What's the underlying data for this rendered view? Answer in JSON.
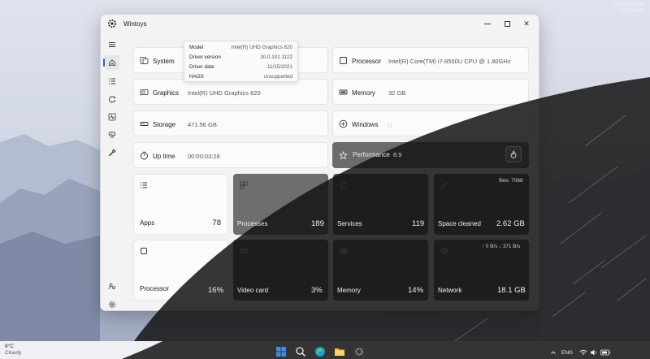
{
  "window": {
    "title": "Wintoys",
    "app_icon": "gear-badge-icon"
  },
  "nav": {
    "items": [
      {
        "name": "home",
        "icon": "home-icon",
        "active": true
      },
      {
        "name": "apps",
        "icon": "list-icon"
      },
      {
        "name": "services",
        "icon": "services-icon"
      },
      {
        "name": "performance",
        "icon": "activity-icon"
      },
      {
        "name": "health",
        "icon": "heart-pulse-icon"
      },
      {
        "name": "tools",
        "icon": "wrench-icon"
      },
      {
        "name": "extras",
        "icon": "people-icon"
      },
      {
        "name": "settings",
        "icon": "gear-icon"
      }
    ]
  },
  "system_info": {
    "system_label": "System",
    "processor_label": "Processor",
    "processor_value": "Intel(R) Core(TM) i7-8550U CPU @ 1.80GHz",
    "graphics_label": "Graphics",
    "graphics_value": "Intel(R) UHD Graphics 620",
    "memory_label": "Memory",
    "memory_value": "32 GB",
    "storage_label": "Storage",
    "storage_value": "471.56 GB",
    "windows_label": "Windows",
    "windows_value": "11",
    "uptime_label": "Up time",
    "uptime_value": "00:00:03:28",
    "performance_label": "Performance",
    "performance_value": "8.9"
  },
  "tooltip": {
    "rows": [
      {
        "key": "Model",
        "value": "Intel(R) UHD Graphics 620"
      },
      {
        "key": "Driver version",
        "value": "30.0.101.1122"
      },
      {
        "key": "Driver date",
        "value": "11/15/2021"
      },
      {
        "key": "HAGS",
        "value": "unsupported"
      }
    ]
  },
  "stats": {
    "apps_label": "Apps",
    "apps_value": "78",
    "processes_label": "Processes",
    "processes_value": "189",
    "services_label": "Services",
    "services_value": "119",
    "space_label": "Space cleaned",
    "space_value": "2.62 GB",
    "space_files": "files: 7068",
    "processor_label": "Processor",
    "processor_value": "16%",
    "videocard_label": "Video card",
    "videocard_value": "3%",
    "memory_label": "Memory",
    "memory_value": "14%",
    "network_label": "Network",
    "network_value": "18.1 GB",
    "network_rate": "↑ 0 B/s  ↓ 371 B/s"
  },
  "taskbar": {
    "temperature": "8°C",
    "condition": "Cloudy",
    "language": "ENG",
    "time": "10:48:26 PM",
    "date": "3/29/2025"
  }
}
